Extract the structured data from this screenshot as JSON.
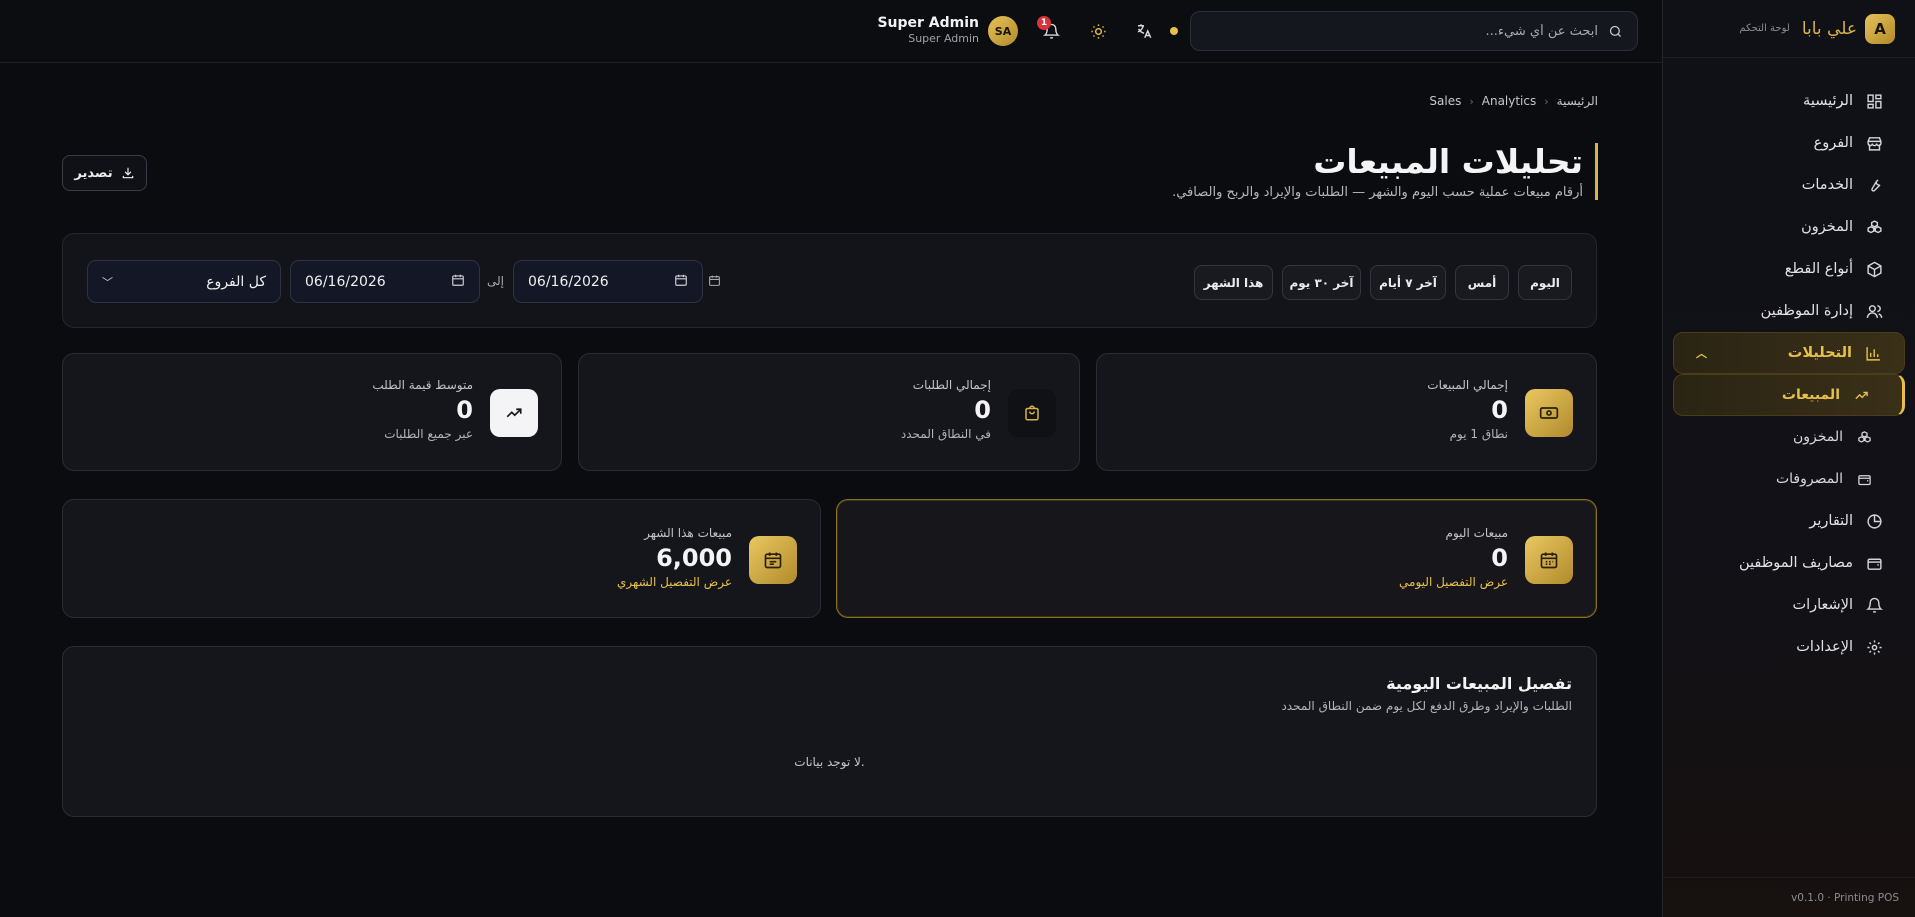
{
  "brand": {
    "name": "علي بابا",
    "sub": "لوحة التحكم",
    "logo": "A"
  },
  "sidebar": {
    "items": [
      {
        "label": "الرئيسية",
        "icon": "dashboard-icon"
      },
      {
        "label": "الفروع",
        "icon": "store-icon"
      },
      {
        "label": "الخدمات",
        "icon": "wrench-icon"
      },
      {
        "label": "المخزون",
        "icon": "boxes-icon"
      },
      {
        "label": "أنواع القطع",
        "icon": "package-icon"
      },
      {
        "label": "إدارة الموظفين",
        "icon": "users-icon"
      },
      {
        "label": "التحليلات",
        "icon": "chart-icon"
      },
      {
        "label": "التقارير",
        "icon": "pie-icon"
      },
      {
        "label": "مصاريف الموظفين",
        "icon": "wallet-icon"
      },
      {
        "label": "الإشعارات",
        "icon": "bell-icon"
      },
      {
        "label": "الإعدادات",
        "icon": "gear-icon"
      }
    ],
    "analytics_sub": [
      {
        "label": "المبيعات",
        "icon": "trend-icon"
      },
      {
        "label": "المخزون",
        "icon": "boxes-icon"
      },
      {
        "label": "المصروفات",
        "icon": "wallet-icon"
      }
    ],
    "footer": "v0.1.0 · Printing POS"
  },
  "topbar": {
    "search_placeholder": "ابحث عن أي شيء...",
    "notifications_count": "1",
    "user_initials": "SA",
    "user_name": "Super Admin",
    "user_role": "Super Admin"
  },
  "breadcrumb": [
    "الرئيسية",
    "Analytics",
    "Sales"
  ],
  "page": {
    "title": "تحليلات المبيعات",
    "subtitle": "أرقام مبيعات عملية حسب اليوم والشهر — الطلبات والإيراد والربح والصافي.",
    "export_label": "تصدير"
  },
  "filters": {
    "chips": [
      "اليوم",
      "أمس",
      "آخر ٧ أيام",
      "آخر ٣٠ يوم",
      "هذا الشهر"
    ],
    "date_from": "06/16/2026",
    "to_label": "إلى",
    "date_to": "06/16/2026",
    "branch": "كل الفروع"
  },
  "stats": {
    "total_sales": {
      "label": "إجمالي المبيعات",
      "value": "0",
      "sub": "نطاق 1 يوم"
    },
    "total_orders": {
      "label": "إجمالي الطلبات",
      "value": "0",
      "sub": "في النطاق المحدد"
    },
    "avg_order": {
      "label": "متوسط قيمة الطلب",
      "value": "0",
      "sub": "عبر جميع الطلبات"
    },
    "today_sales": {
      "label": "مبيعات اليوم",
      "value": "0",
      "sub": "عرض التفصيل اليومي"
    },
    "month_sales": {
      "label": "مبيعات هذا الشهر",
      "value": "6,000",
      "sub": "عرض التفصيل الشهري"
    }
  },
  "daily_detail": {
    "title": "تفصيل المبيعات اليومية",
    "subtitle": "الطلبات والإيراد وطرق الدفع لكل يوم ضمن النطاق المحدد",
    "empty": "لا توجد بيانات."
  },
  "colors": {
    "accent": "#e7c049",
    "background": "#0b0c10",
    "card": "#15161b"
  }
}
